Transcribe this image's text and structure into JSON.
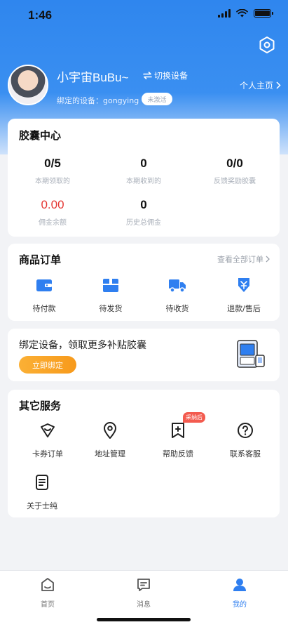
{
  "status": {
    "time": "1:46"
  },
  "profile": {
    "username": "小宇宙BuBu~",
    "switch_device": "切换设备",
    "bound_device_label": "绑定的设备：gongying",
    "device_badge": "未激活",
    "homepage_link": "个人主页"
  },
  "capsule_center": {
    "title": "胶囊中心",
    "stats": [
      {
        "value": "0/5",
        "label": "本期领取的"
      },
      {
        "value": "0",
        "label": "本期收到的"
      },
      {
        "value": "0/0",
        "label": "反馈奖励胶囊"
      },
      {
        "value": "0.00",
        "label": "佣金余额"
      },
      {
        "value": "0",
        "label": "历史总佣金"
      }
    ]
  },
  "orders": {
    "title": "商品订单",
    "view_all": "查看全部订单",
    "items": [
      {
        "label": "待付款",
        "icon": "wallet-icon"
      },
      {
        "label": "待发货",
        "icon": "package-icon"
      },
      {
        "label": "待收货",
        "icon": "truck-icon"
      },
      {
        "label": "退款/售后",
        "icon": "refund-icon"
      }
    ]
  },
  "bind_banner": {
    "text": "绑定设备，领取更多补贴胶囊",
    "button": "立即绑定"
  },
  "services": {
    "title": "其它服务",
    "new_badge": "采纳后",
    "items": [
      {
        "label": "卡券订单",
        "icon": "coupon-icon"
      },
      {
        "label": "地址管理",
        "icon": "location-icon"
      },
      {
        "label": "帮助反馈",
        "icon": "feedback-icon"
      },
      {
        "label": "联系客服",
        "icon": "help-icon"
      },
      {
        "label": "关于士纯",
        "icon": "document-icon"
      }
    ]
  },
  "tabbar": {
    "items": [
      {
        "label": "首页",
        "icon": "home-icon"
      },
      {
        "label": "消息",
        "icon": "message-icon"
      },
      {
        "label": "我的",
        "icon": "profile-icon"
      }
    ]
  },
  "colors": {
    "accent": "#2f7ff0",
    "orange": "#f79a1c",
    "red": "#e53935"
  }
}
